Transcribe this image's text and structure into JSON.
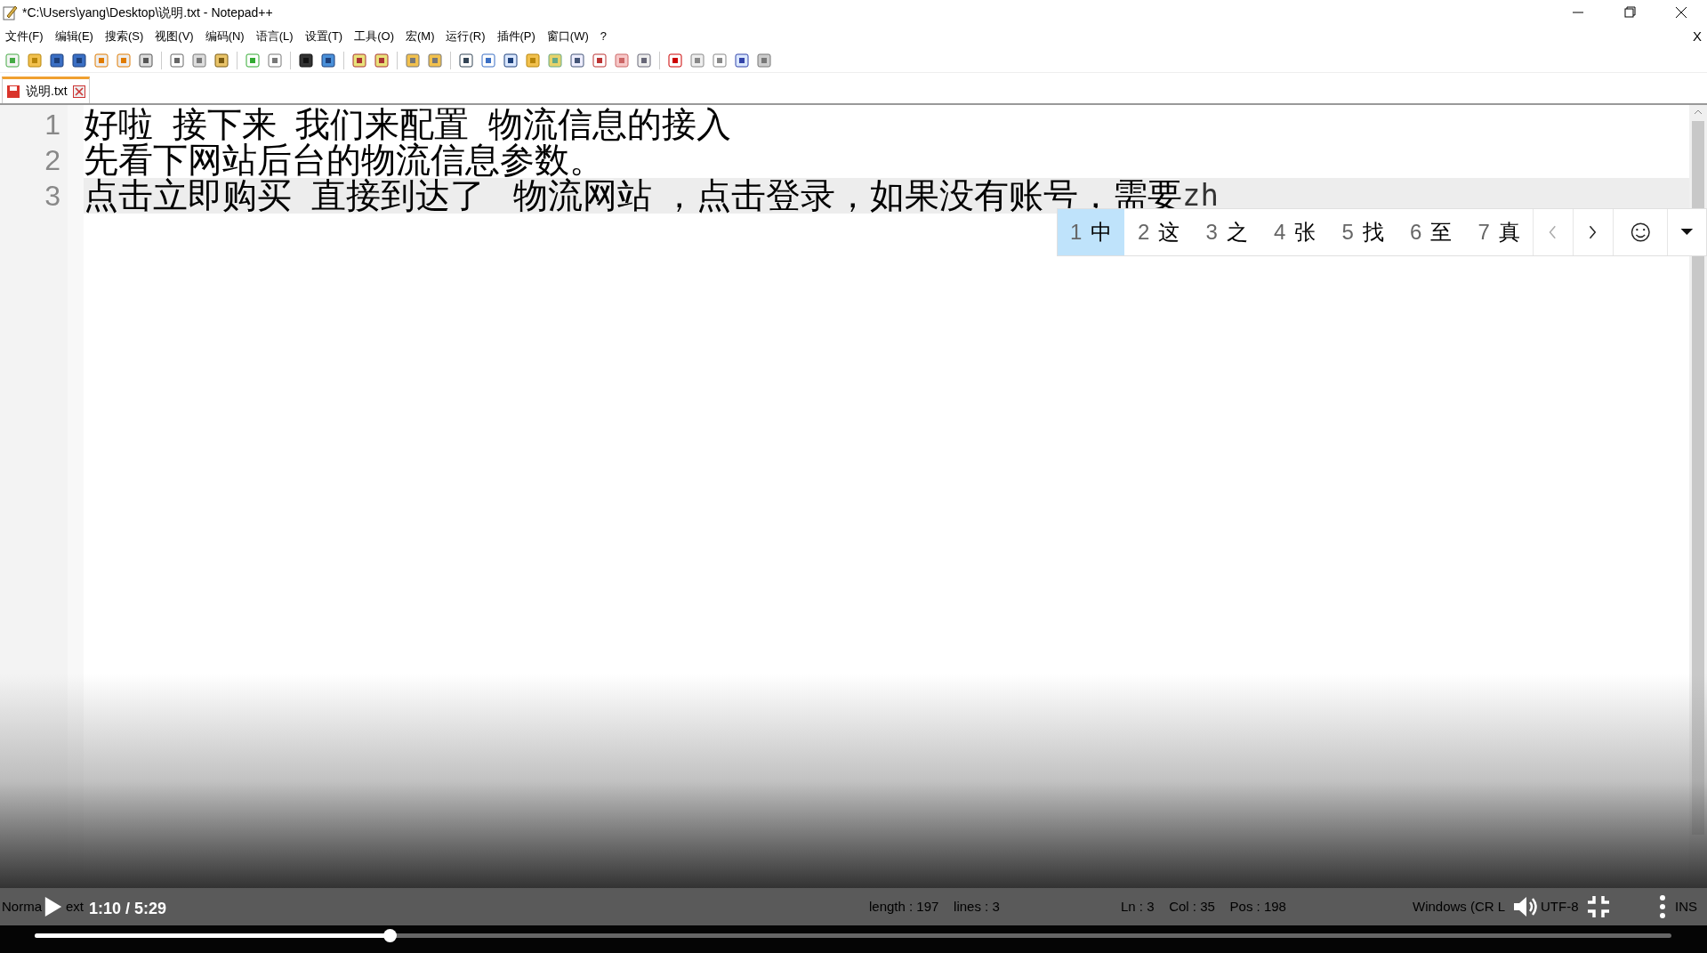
{
  "window": {
    "title": "*C:\\Users\\yang\\Desktop\\说明.txt - Notepad++",
    "close_document": "X"
  },
  "menu": [
    "文件(F)",
    "编辑(E)",
    "搜索(S)",
    "视图(V)",
    "编码(N)",
    "语言(L)",
    "设置(T)",
    "工具(O)",
    "宏(M)",
    "运行(R)",
    "插件(P)",
    "窗口(W)",
    "?"
  ],
  "tabs": [
    {
      "label": "说明.txt",
      "selected": true,
      "modified": true
    }
  ],
  "editor": {
    "lines": [
      {
        "number": "1",
        "text": "好啦  接下来  我们来配置  物流信息的接入",
        "current": false
      },
      {
        "number": "2",
        "text": "先看下网站后台的物流信息参数。",
        "current": false
      },
      {
        "number": "3",
        "text": "点击立即购买  直接到达了   物流网站 ，点击登录，如果没有账号，需要",
        "composition": "zh",
        "current": true
      }
    ]
  },
  "ime": {
    "candidates": [
      {
        "index": "1",
        "text": "中",
        "selected": true
      },
      {
        "index": "2",
        "text": "这",
        "selected": false
      },
      {
        "index": "3",
        "text": "之",
        "selected": false
      },
      {
        "index": "4",
        "text": "张",
        "selected": false
      },
      {
        "index": "5",
        "text": "找",
        "selected": false
      },
      {
        "index": "6",
        "text": "至",
        "selected": false
      },
      {
        "index": "7",
        "text": "真",
        "selected": false
      }
    ]
  },
  "status_bar": [
    "Norma",
    "ext",
    "length : 197    lines : 3",
    "Ln : 3    Col : 35    Pos : 198",
    "Windows (CR L",
    "UTF-8",
    "INS"
  ],
  "player": {
    "time": "1:10 / 5:29",
    "playing": false,
    "level": 0.217
  }
}
